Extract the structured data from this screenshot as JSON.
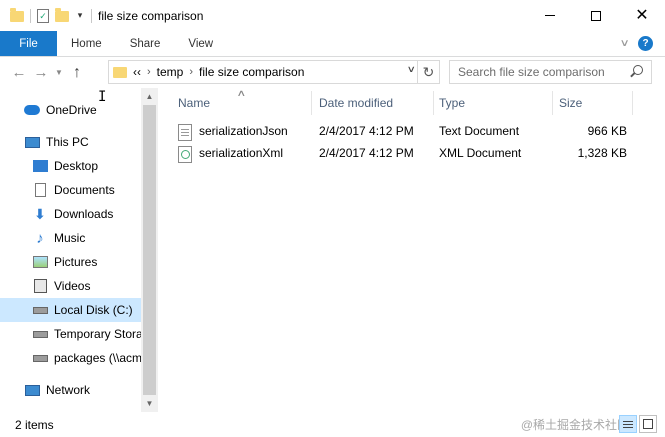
{
  "window": {
    "title": "file size comparison",
    "controls": {
      "minimize": "minimize-icon",
      "maximize": "maximize-icon",
      "close": "✕"
    }
  },
  "ribbon": {
    "tabs": [
      {
        "label": "File"
      },
      {
        "label": "Home"
      },
      {
        "label": "Share"
      },
      {
        "label": "View"
      }
    ],
    "help": "?"
  },
  "nav": {
    "back": "←",
    "forward": "→",
    "up": "↑",
    "breadcrumb": [
      "temp",
      "file size comparison"
    ],
    "overflow": "‹‹",
    "refresh": "↻",
    "search_placeholder": "Search file size comparison"
  },
  "sidebar": {
    "items": [
      {
        "label": "OneDrive",
        "icon": "onedrive-icon"
      },
      {
        "label": "This PC",
        "icon": "pc-icon"
      },
      {
        "label": "Desktop",
        "icon": "desktop-icon"
      },
      {
        "label": "Documents",
        "icon": "documents-icon"
      },
      {
        "label": "Downloads",
        "icon": "downloads-icon"
      },
      {
        "label": "Music",
        "icon": "music-icon"
      },
      {
        "label": "Pictures",
        "icon": "pictures-icon"
      },
      {
        "label": "Videos",
        "icon": "videos-icon"
      },
      {
        "label": "Local Disk (C:)",
        "icon": "disk-icon",
        "selected": true
      },
      {
        "label": "Temporary Stora",
        "icon": "disk-icon"
      },
      {
        "label": "packages (\\\\acm",
        "icon": "network-drive-icon"
      },
      {
        "label": "Network",
        "icon": "network-icon"
      }
    ]
  },
  "files": {
    "columns": [
      "Name",
      "Date modified",
      "Type",
      "Size"
    ],
    "rows": [
      {
        "name": "serializationJson",
        "date": "2/4/2017 4:12 PM",
        "type": "Text Document",
        "size": "966 KB",
        "icon": "text-file-icon"
      },
      {
        "name": "serializationXml",
        "date": "2/4/2017 4:12 PM",
        "type": "XML Document",
        "size": "1,328 KB",
        "icon": "xml-file-icon"
      }
    ]
  },
  "status": {
    "item_count": "2 items",
    "watermark": "@稀土掘金技术社区"
  },
  "colors": {
    "file_tab": "#1979ca",
    "selected": "#cce8ff",
    "header_text": "#4c607a",
    "folder": "#f8d775"
  }
}
